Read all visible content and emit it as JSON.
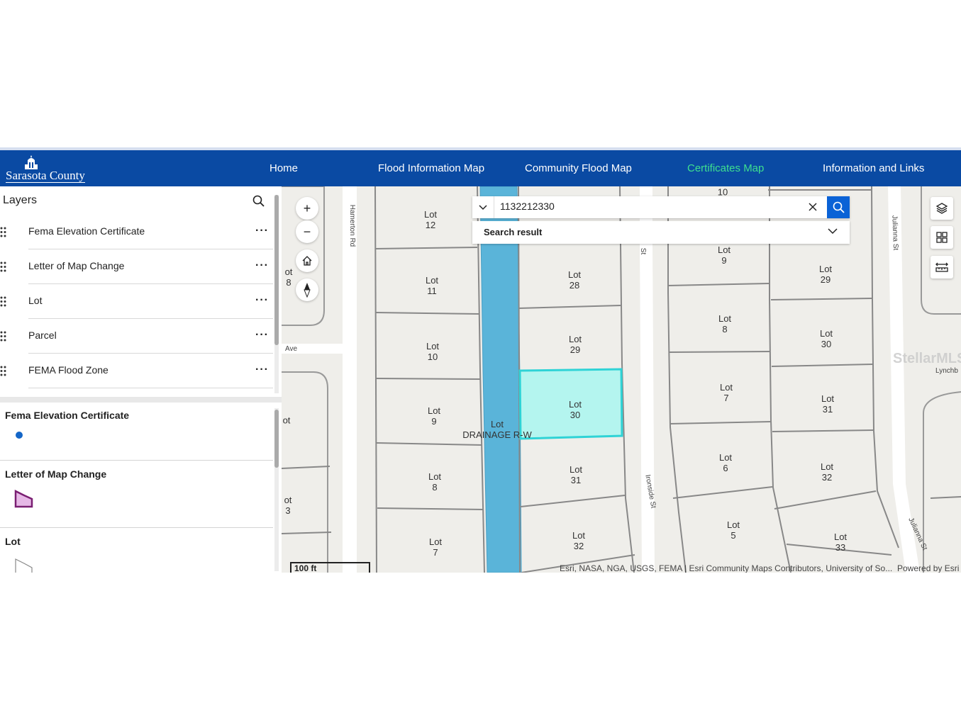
{
  "header": {
    "logo_text": "Sarasota County",
    "nav": [
      {
        "label": "Home",
        "active": false
      },
      {
        "label": "Flood Information Map",
        "active": false
      },
      {
        "label": "Community Flood Map",
        "active": false
      },
      {
        "label": "Certificates Map",
        "active": true
      },
      {
        "label": "Information and Links",
        "active": false
      }
    ],
    "colors": {
      "bar": "#0a4aa3",
      "active": "#3ee08f"
    }
  },
  "layers_panel": {
    "title": "Layers",
    "search_icon": "search-icon",
    "items": [
      {
        "label": "Fema Elevation Certificate"
      },
      {
        "label": "Letter of Map Change"
      },
      {
        "label": "Lot"
      },
      {
        "label": "Parcel"
      },
      {
        "label": "FEMA Flood Zone"
      }
    ]
  },
  "legend": {
    "sections": [
      {
        "title": "Fema Elevation Certificate",
        "symbol": "blue-dot"
      },
      {
        "title": "Letter of Map Change",
        "symbol": "pink-polygon"
      },
      {
        "title": "Lot",
        "symbol": "gray-outline-polygon"
      }
    ]
  },
  "search": {
    "value": "1132212330",
    "results_label": "Search result"
  },
  "map": {
    "lots": [
      {
        "label": "Lot\n12"
      },
      {
        "label": "Lot\n11"
      },
      {
        "label": "Lot\n10"
      },
      {
        "label": "Lot\n9"
      },
      {
        "label": "Lot\n8"
      },
      {
        "label": "Lot\n7"
      },
      {
        "label": "Lot\n28"
      },
      {
        "label": "Lot\n29"
      },
      {
        "label": "Lot\n30"
      },
      {
        "label": "Lot\n31"
      },
      {
        "label": "Lot\n32"
      },
      {
        "label": "10"
      },
      {
        "label": "Lot\n9"
      },
      {
        "label": "Lot\n8"
      },
      {
        "label": "Lot\n7"
      },
      {
        "label": "Lot\n6"
      },
      {
        "label": "Lot\n5"
      },
      {
        "label": "Lot\n29"
      },
      {
        "label": "Lot\n30"
      },
      {
        "label": "Lot\n31"
      },
      {
        "label": "Lot\n32"
      },
      {
        "label": "Lot\n33"
      }
    ],
    "drainage_label": "Lot\nDRAINAGE R-W",
    "edge_labels": [
      "ot\n8",
      "ot",
      "ot\n3"
    ],
    "streets": {
      "hamerton": "Hamerton Rd",
      "ave": "Ave",
      "st_top": "St",
      "ironside": "Ironside St",
      "julianna_top": "Julianna St",
      "julianna_bottom": "Julianna St",
      "lynch": "Lynchb"
    },
    "watermark": "StellarMLS",
    "scale_label": "100 ft",
    "attribution": "Esri, NASA, NGA, USGS, FEMA | Esri Community Maps Contributors, University of So...",
    "powered_by": "Powered by Esri",
    "colors": {
      "water": "#5ab4d9",
      "selected_fill": "#b4f5ef",
      "selected_stroke": "#2fd3d6"
    }
  }
}
